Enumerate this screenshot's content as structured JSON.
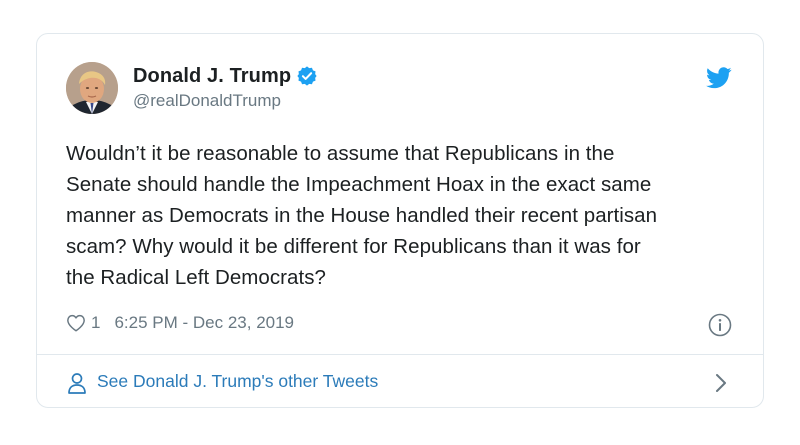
{
  "author": {
    "display_name": "Donald J. Trump",
    "handle": "@realDonaldTrump",
    "verified": true,
    "avatar": "profile-photo"
  },
  "tweet": {
    "lines": [
      "Wouldn’t it be reasonable to assume that Republicans in the",
      "Senate should handle the Impeachment Hoax in the exact same",
      "manner as Democrats in the House handled their recent partisan",
      "scam? Why would it be different for Republicans than it was for",
      "the Radical Left Democrats?"
    ],
    "like_count": "1",
    "timestamp": "6:25 PM - Dec 23, 2019"
  },
  "footer": {
    "other_tweets_label": "See Donald J. Trump's other Tweets"
  },
  "icons": {
    "verified": "verified-badge-icon",
    "bird": "twitter-bird-icon",
    "like": "heart-icon",
    "info": "info-icon",
    "person": "person-icon",
    "chevron": "chevron-right-icon"
  },
  "colors": {
    "text": "#1c2022",
    "secondary": "#697882",
    "link": "#2b7bb9",
    "twitter_blue": "#1da1f2",
    "border": "#e1e8ed"
  }
}
